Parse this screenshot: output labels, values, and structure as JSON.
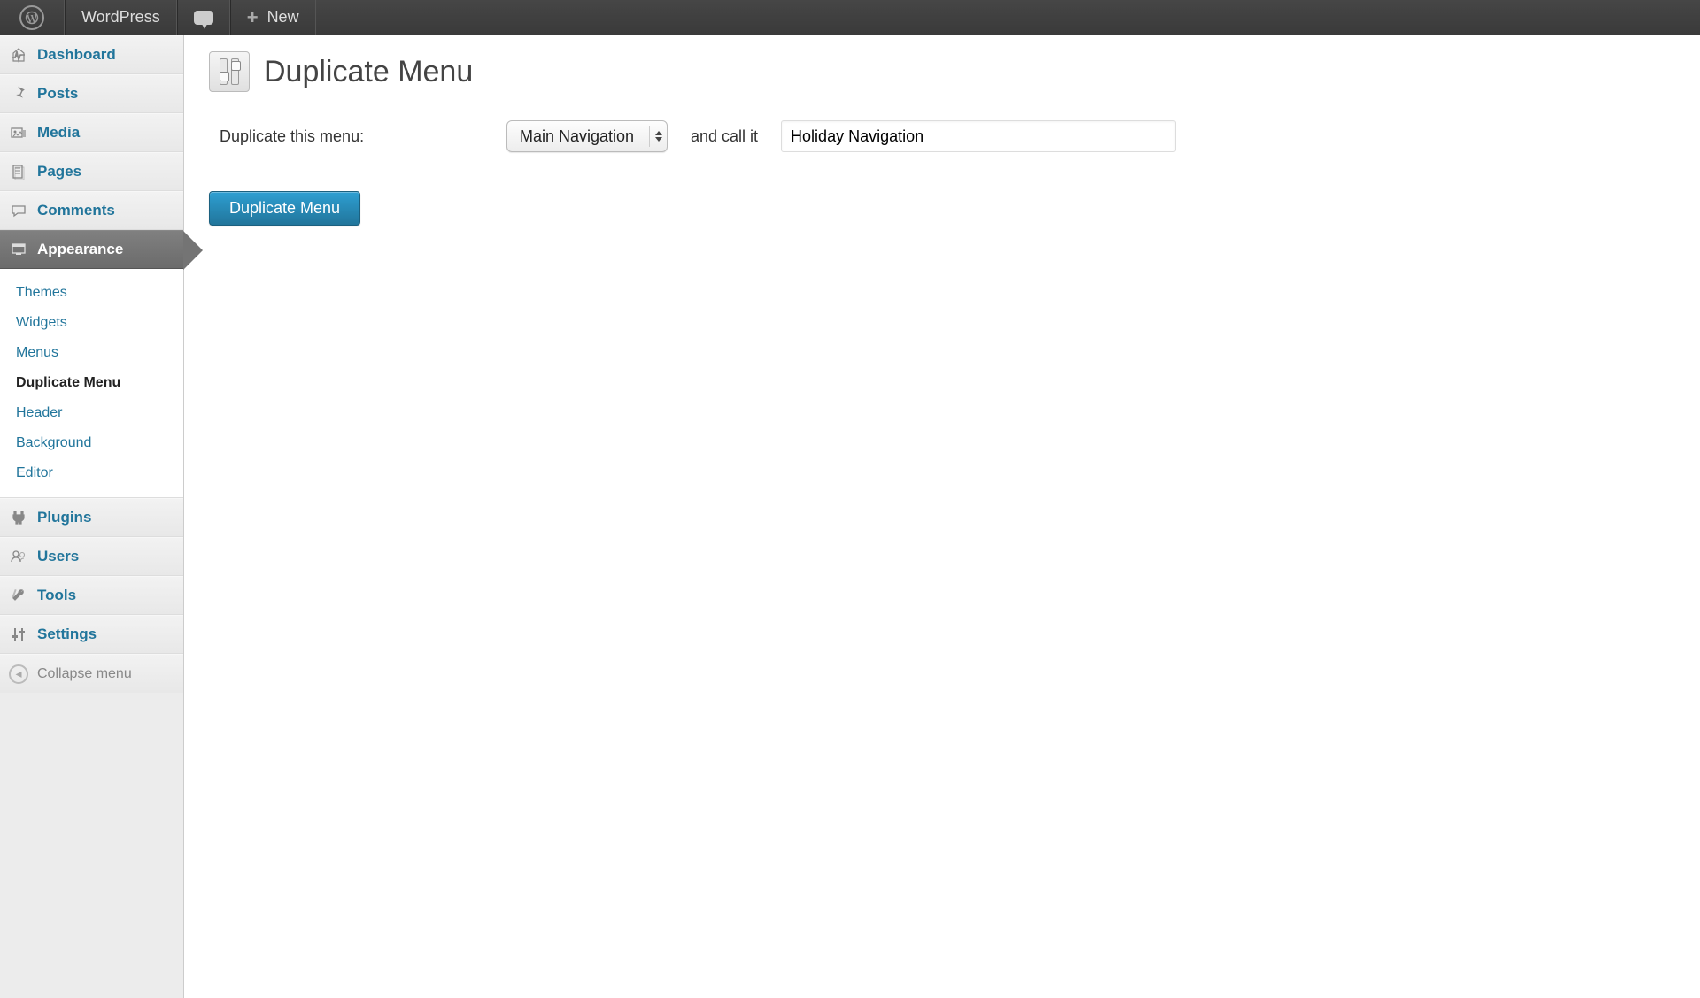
{
  "adminBar": {
    "siteName": "WordPress",
    "newLabel": "New"
  },
  "sidebar": {
    "items": [
      {
        "label": "Dashboard"
      },
      {
        "label": "Posts"
      },
      {
        "label": "Media"
      },
      {
        "label": "Pages"
      },
      {
        "label": "Comments"
      },
      {
        "label": "Appearance"
      },
      {
        "label": "Plugins"
      },
      {
        "label": "Users"
      },
      {
        "label": "Tools"
      },
      {
        "label": "Settings"
      }
    ],
    "appearanceSubmenu": [
      {
        "label": "Themes"
      },
      {
        "label": "Widgets"
      },
      {
        "label": "Menus"
      },
      {
        "label": "Duplicate Menu"
      },
      {
        "label": "Header"
      },
      {
        "label": "Background"
      },
      {
        "label": "Editor"
      }
    ],
    "collapseLabel": "Collapse menu"
  },
  "page": {
    "title": "Duplicate Menu",
    "form": {
      "sourceLabel": "Duplicate this menu:",
      "sourceSelected": "Main Navigation",
      "midLabel": "and call it",
      "nameValue": "Holiday Navigation",
      "submitLabel": "Duplicate Menu"
    }
  }
}
